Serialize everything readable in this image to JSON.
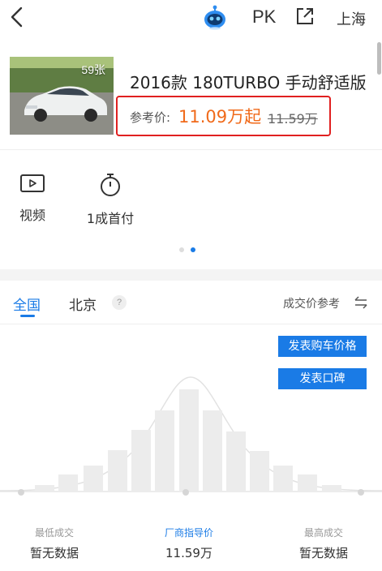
{
  "header": {
    "pk_label": "PK",
    "city": "上海"
  },
  "car": {
    "photo_count": "59张",
    "name": "2016款 180TURBO 手动舒适版",
    "price_label": "参考价:",
    "price_value": "11.09万起",
    "price_original": "11.59万"
  },
  "quick_links": [
    {
      "label": "视频",
      "icon": "video-icon"
    },
    {
      "label": "1成首付",
      "icon": "stopwatch-icon"
    }
  ],
  "pager": {
    "count": 2,
    "active": 2
  },
  "region_tabs": {
    "items": [
      {
        "label": "全国",
        "active": true
      },
      {
        "label": "北京",
        "active": false
      }
    ],
    "help_label": "?",
    "deal_price_label": "成交价参考"
  },
  "actions": {
    "post_price_label": "发表购车价格",
    "post_review_label": "发表口碑"
  },
  "stats": {
    "lowest_label": "最低成交",
    "lowest_value": "暂无数据",
    "guide_label": "厂商指导价",
    "guide_value": "11.59万",
    "highest_label": "最高成交",
    "highest_value": "暂无数据"
  },
  "colors": {
    "accent_blue": "#1a7be6",
    "price_orange": "#f06a1a",
    "highlight_red": "#e02020",
    "bar_gray": "#ececec"
  }
}
